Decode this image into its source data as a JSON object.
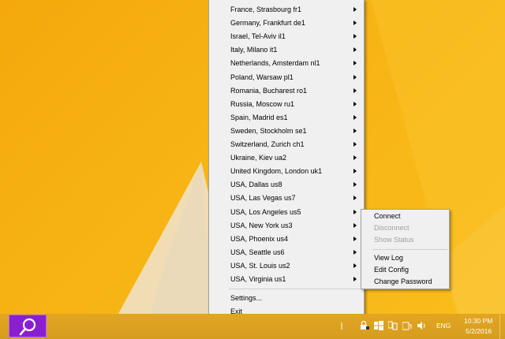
{
  "main_menu": {
    "servers": [
      "France, Strasbourg fr1",
      "Germany, Frankfurt de1",
      "Israel, Tel-Aviv il1",
      "Italy, Milano it1",
      "Netherlands, Amsterdam nl1",
      "Poland, Warsaw pl1",
      "Romania, Bucharest ro1",
      "Russia, Moscow ru1",
      "Spain, Madrid es1",
      "Sweden, Stockholm se1",
      "Switzerland, Zurich ch1",
      "Ukraine, Kiev ua2",
      "United Kingdom, London uk1",
      "USA, Dallas us8",
      "USA, Las Vegas us7",
      "USA, Los Angeles us5",
      "USA, New York us3",
      "USA, Phoenix us4",
      "USA, Seattle us6",
      "USA, St. Louis us2",
      "USA, Virginia us1"
    ],
    "settings_label": "Settings...",
    "exit_label": "Exit"
  },
  "sub_menu": {
    "connect": "Connect",
    "disconnect": "Disconnect",
    "show_status": "Show Status",
    "view_log": "View Log",
    "edit_config": "Edit Config",
    "change_password": "Change Password"
  },
  "taskbar": {
    "search_icon": "search-icon",
    "language": "ENG",
    "time": "10:30 PM",
    "date": "5/2/2016"
  },
  "colors": {
    "wallpaper": "#f7b414",
    "taskbar": "#dba020",
    "search_button": "#8a1fd0",
    "menu_bg": "#f0f0f0",
    "disabled_text": "#a0a0a0"
  }
}
